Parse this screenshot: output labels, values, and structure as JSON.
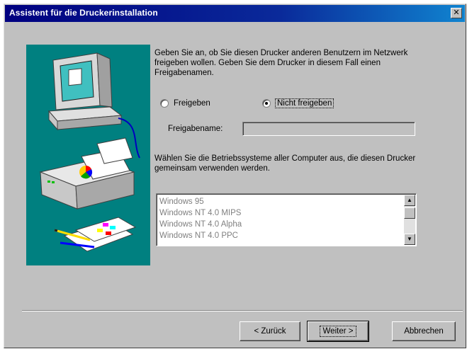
{
  "window": {
    "title": "Assistent für die Druckerinstallation",
    "close_glyph": "✕"
  },
  "intro_text": "Geben Sie an, ob Sie diesen Drucker anderen Benutzern im Netzwerk freigeben wollen. Geben Sie dem Drucker in diesem Fall einen Freigabenamen.",
  "share_options": {
    "share_label": "Freigeben",
    "no_share_label": "Nicht freigeben",
    "selected": "Nicht freigeben"
  },
  "share_name": {
    "label": "Freigabename:",
    "value": ""
  },
  "os_prompt": "Wählen Sie die Betriebssysteme aller Computer aus, die diesen Drucker gemeinsam verwenden werden.",
  "os_list": [
    "Windows 95",
    "Windows NT 4.0 MIPS",
    "Windows NT 4.0 Alpha",
    "Windows NT 4.0 PPC"
  ],
  "buttons": {
    "back": "< Zurück",
    "next": "Weiter >",
    "cancel": "Abbrechen"
  },
  "icons": {
    "scroll_up": "▲",
    "scroll_down": "▼"
  }
}
